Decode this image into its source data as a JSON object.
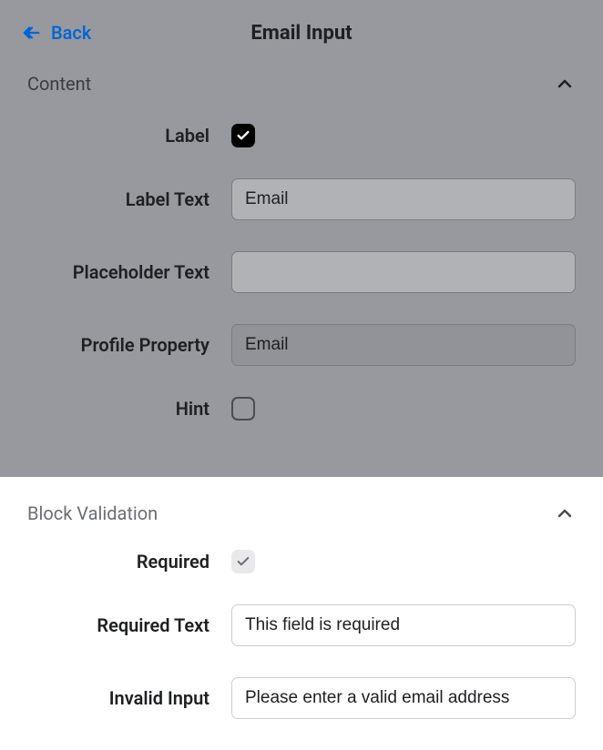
{
  "header": {
    "back_label": "Back",
    "title": "Email Input"
  },
  "content_section": {
    "title": "Content",
    "fields": {
      "label": {
        "name": "Label",
        "checked": true
      },
      "label_text": {
        "name": "Label Text",
        "value": "Email"
      },
      "placeholder_text": {
        "name": "Placeholder Text",
        "value": ""
      },
      "profile_property": {
        "name": "Profile Property",
        "value": "Email"
      },
      "hint": {
        "name": "Hint",
        "checked": false
      }
    }
  },
  "validation_section": {
    "title": "Block Validation",
    "fields": {
      "required": {
        "name": "Required",
        "checked": true
      },
      "required_text": {
        "name": "Required Text",
        "value": "This field is required"
      },
      "invalid_input": {
        "name": "Invalid Input",
        "value": "Please enter a valid email address"
      }
    }
  }
}
